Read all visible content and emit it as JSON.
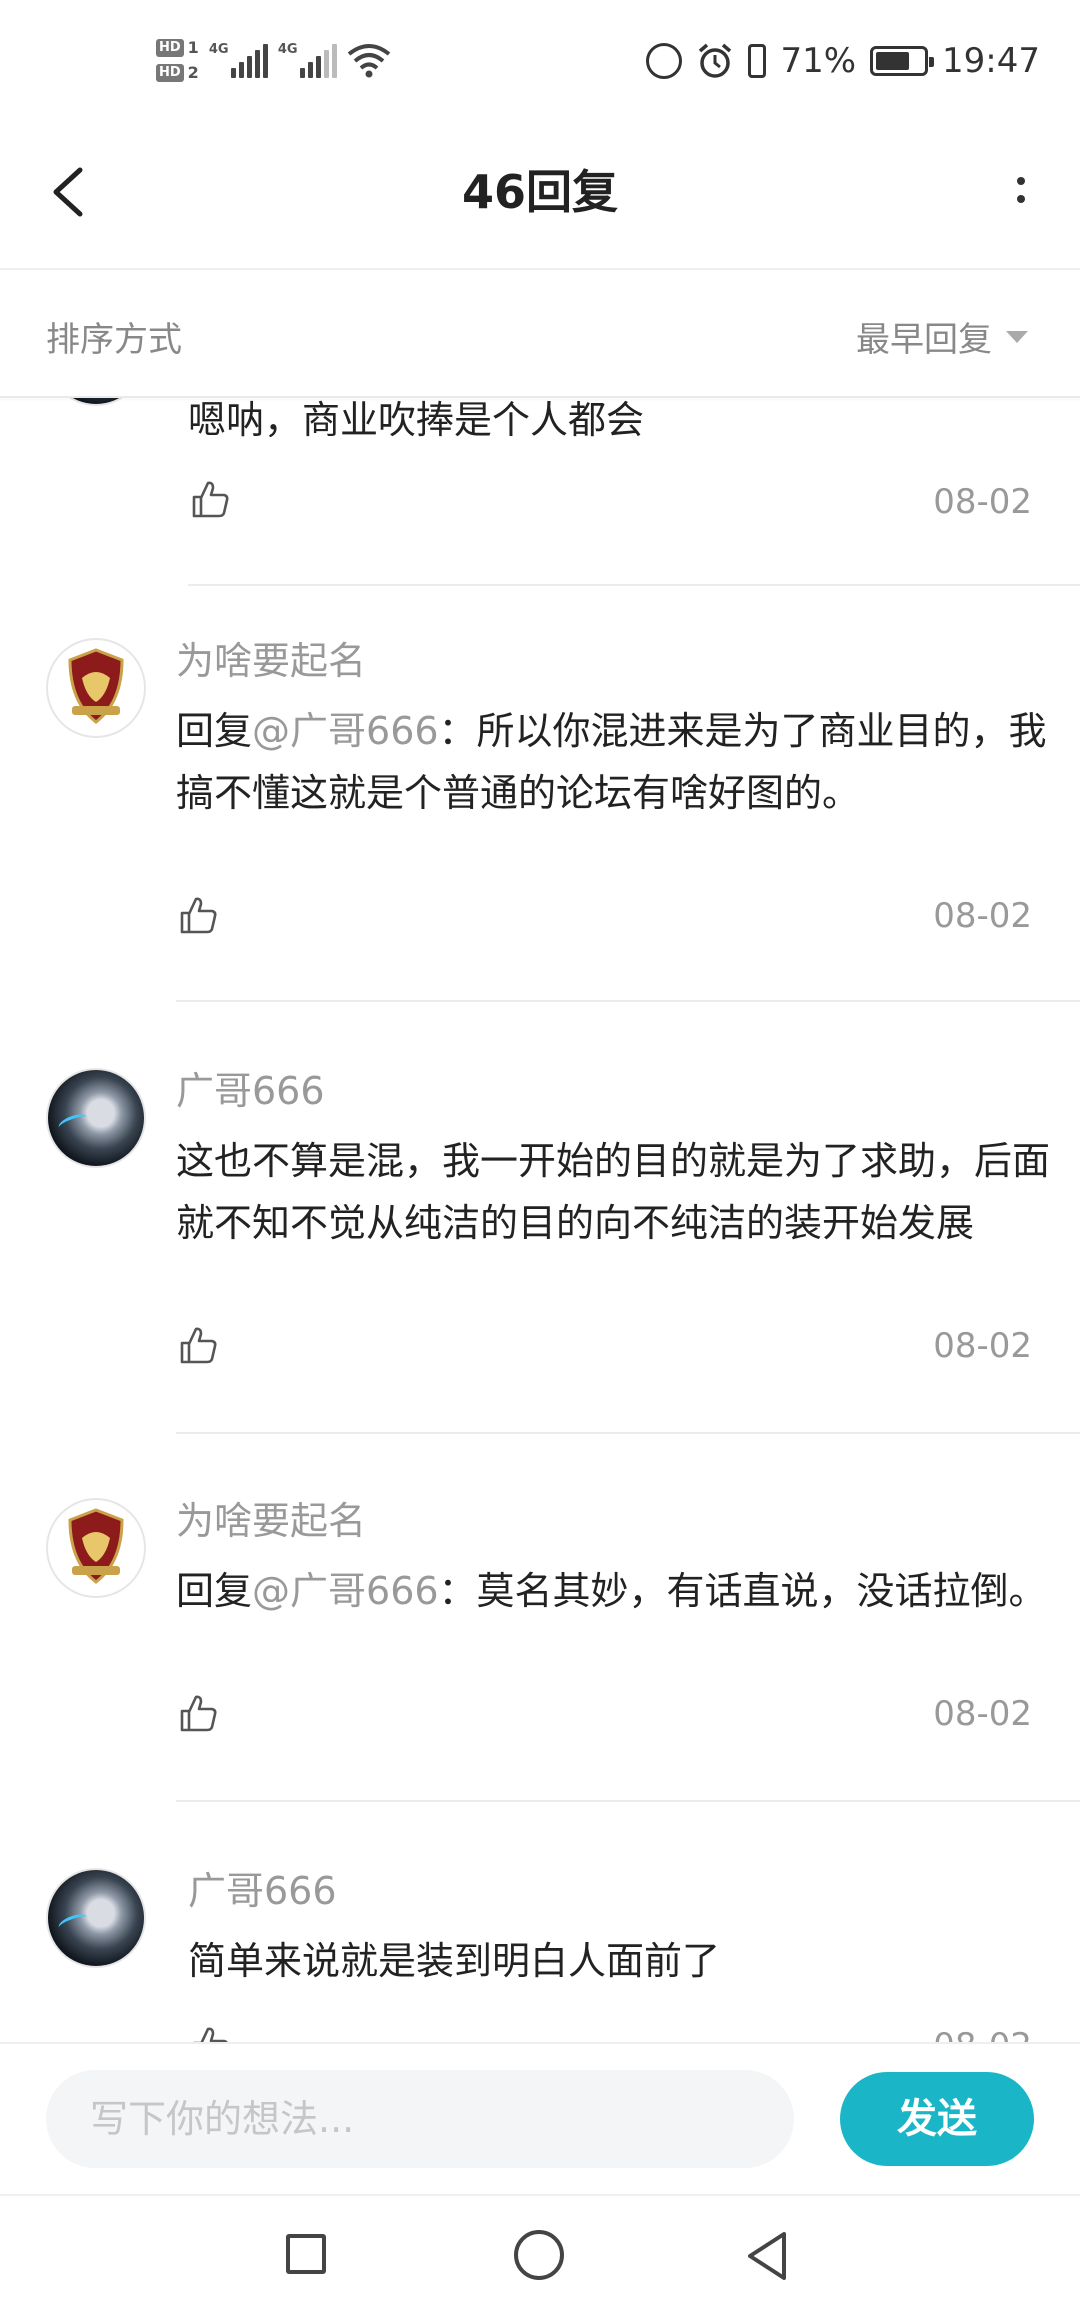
{
  "status_bar": {
    "sim1": "HD",
    "sim1_num": "1",
    "sim2": "HD",
    "sim2_num": "2",
    "net1": "4G",
    "net2": "4G",
    "battery": "71%",
    "battery_level": 0.71,
    "time": "19:47"
  },
  "header": {
    "title": "46回复",
    "back_icon": "chevron-left-icon",
    "more_icon": "more-vertical-icon"
  },
  "sort": {
    "label": "排序方式",
    "value": "最早回复"
  },
  "replies": [
    {
      "username": "",
      "avatar": "anime-avatar",
      "content": "嗯呐，商业吹捧是个人都会",
      "mention": "",
      "date": "08-02"
    },
    {
      "username": "为啥要起名",
      "avatar": "crest-avatar",
      "prefix": "回复",
      "mention": "@广哥666",
      "content": "：所以你混进来是为了商业目的，我搞不懂这就是个普通的论坛有啥好图的。",
      "date": "08-02"
    },
    {
      "username": "广哥666",
      "avatar": "anime-avatar",
      "content": "这也不算是混，我一开始的目的就是为了求助，后面就不知不觉从纯洁的目的向不纯洁的装开始发展",
      "date": "08-02"
    },
    {
      "username": "为啥要起名",
      "avatar": "crest-avatar",
      "prefix": "回复",
      "mention": "@广哥666",
      "content": "：莫名其妙，有话直说，没话拉倒。",
      "date": "08-02"
    },
    {
      "username": "广哥666",
      "avatar": "anime-avatar",
      "content": "简单来说就是装到明白人面前了",
      "date": "08-02"
    }
  ],
  "input": {
    "placeholder": "写下你的想法...",
    "send_label": "发送"
  },
  "colors": {
    "accent": "#1ab6c7",
    "muted_text": "#999999",
    "body_text": "#222222"
  }
}
